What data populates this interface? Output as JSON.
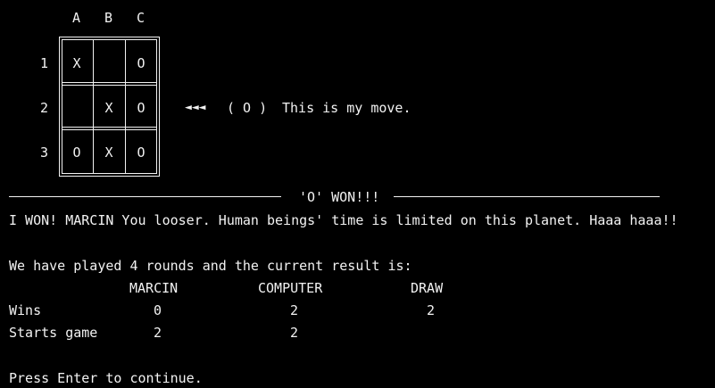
{
  "board": {
    "col_labels": [
      "A",
      "B",
      "C"
    ],
    "row_labels": [
      "1",
      "2",
      "3"
    ],
    "cells": [
      [
        "X",
        "",
        "O"
      ],
      [
        "",
        "X",
        "O"
      ],
      [
        "O",
        "X",
        "O"
      ]
    ]
  },
  "move_line": {
    "arrows": "◄◄◄",
    "player": "( O )",
    "message": "This is my move."
  },
  "winner_banner": "'O' WON!!!",
  "taunt": "I WON! MARCIN You looser. Human beings' time is limited on this planet. Haaa haaa!!",
  "summary": {
    "intro": "We have played 4 rounds and the current result is:",
    "headers": [
      "MARCIN",
      "COMPUTER",
      "DRAW"
    ],
    "rows": [
      {
        "label": "Wins",
        "values": [
          "0",
          "2",
          "2"
        ]
      },
      {
        "label": "Starts game",
        "values": [
          "2",
          "2",
          ""
        ]
      }
    ]
  },
  "prompt": "Press Enter to continue.",
  "colors": {
    "background": "#000000",
    "foreground": "#f2f2f2"
  }
}
